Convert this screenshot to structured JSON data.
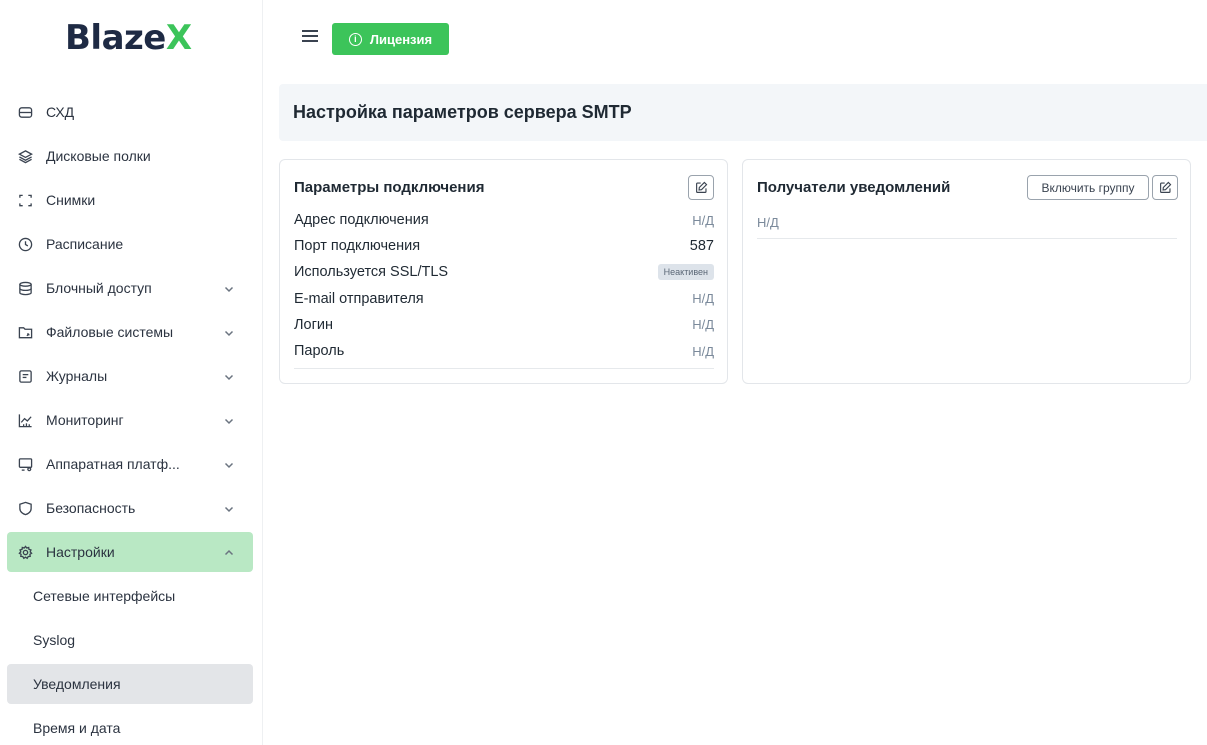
{
  "app": {
    "logo_main": "Blaze",
    "logo_accent": "X"
  },
  "sidebar": {
    "items": [
      {
        "label": "СХД",
        "icon": "storage-icon",
        "has_chevron": false
      },
      {
        "label": "Дисковые полки",
        "icon": "layers-icon",
        "has_chevron": false
      },
      {
        "label": "Снимки",
        "icon": "snapshot-icon",
        "has_chevron": false
      },
      {
        "label": "Расписание",
        "icon": "clock-icon",
        "has_chevron": false
      },
      {
        "label": "Блочный доступ",
        "icon": "database-icon",
        "has_chevron": true
      },
      {
        "label": "Файловые системы",
        "icon": "folder-icon",
        "has_chevron": true
      },
      {
        "label": "Журналы",
        "icon": "log-icon",
        "has_chevron": true
      },
      {
        "label": "Мониторинг",
        "icon": "chart-icon",
        "has_chevron": true
      },
      {
        "label": "Аппаратная платф...",
        "icon": "hardware-icon",
        "has_chevron": true
      },
      {
        "label": "Безопасность",
        "icon": "shield-icon",
        "has_chevron": true
      },
      {
        "label": "Настройки",
        "icon": "gear-icon",
        "has_chevron": true,
        "expanded": true,
        "active": true
      }
    ],
    "subitems": [
      {
        "label": "Сетевые интерфейсы"
      },
      {
        "label": "Syslog"
      },
      {
        "label": "Уведомления",
        "selected": true
      },
      {
        "label": "Время и дата"
      }
    ]
  },
  "topbar": {
    "license_label": "Лицензия",
    "license_color": "#3cc45a"
  },
  "page": {
    "title": "Настройка параметров сервера SMTP"
  },
  "connection": {
    "title": "Параметры подключения",
    "rows": [
      {
        "label": "Адрес подключения",
        "value": "Н/Д"
      },
      {
        "label": "Порт подключения",
        "value": "587"
      },
      {
        "label": "Используется SSL/TLS",
        "value": "Неактивен"
      },
      {
        "label": "E-mail отправителя",
        "value": "Н/Д"
      },
      {
        "label": "Логин",
        "value": "Н/Д"
      },
      {
        "label": "Пароль",
        "value": "Н/Д"
      }
    ]
  },
  "recipients": {
    "title": "Получатели уведомлений",
    "enable_group_label": "Включить группу",
    "empty_value": "Н/Д"
  },
  "colors": {
    "accent": "#3cc45a",
    "active_nav": "#b9e8c4",
    "selected_sub": "#e3e5e8"
  }
}
